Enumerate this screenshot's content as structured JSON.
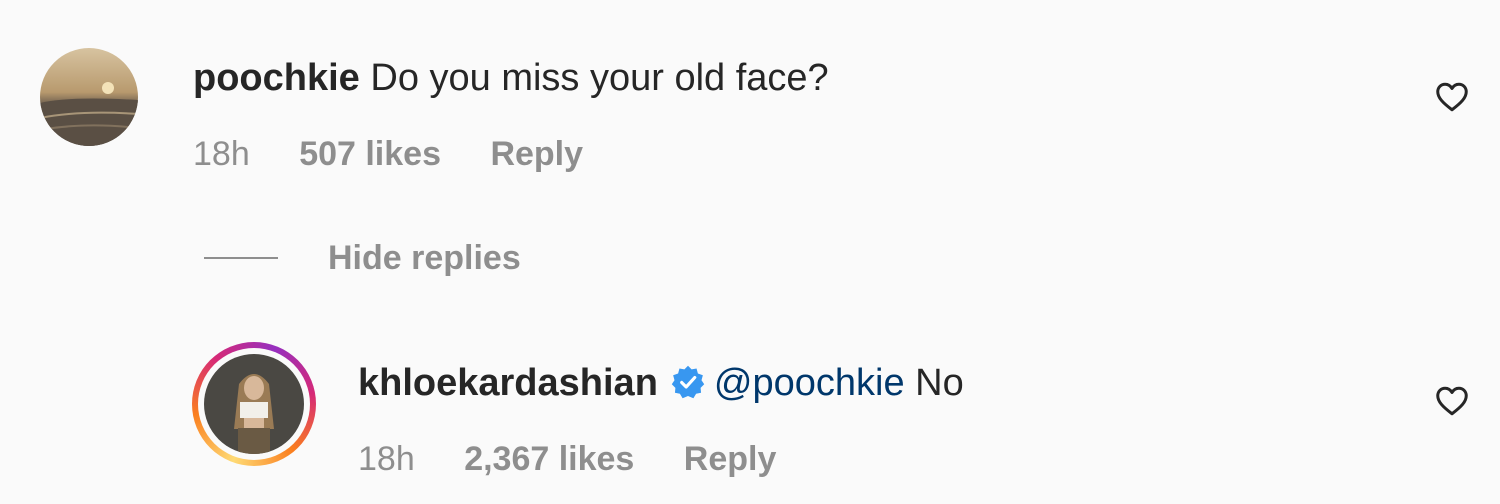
{
  "comment": {
    "username": "poochkie",
    "text": "Do you miss your old face?",
    "time": "18h",
    "likes": "507 likes",
    "reply_label": "Reply",
    "like_icon": "heart-outline-icon"
  },
  "hide_replies_label": "Hide replies",
  "reply": {
    "username": "khloekardashian",
    "verified_icon": "verified-badge-icon",
    "mention": "@poochkie",
    "text": "No",
    "time": "18h",
    "likes": "2,367 likes",
    "reply_label": "Reply",
    "like_icon": "heart-outline-icon",
    "story_ring": true
  },
  "colors": {
    "background": "#fafafa",
    "text": "#262626",
    "secondary": "#8e8e8e",
    "mention": "#00376b",
    "verified": "#3897f0"
  }
}
